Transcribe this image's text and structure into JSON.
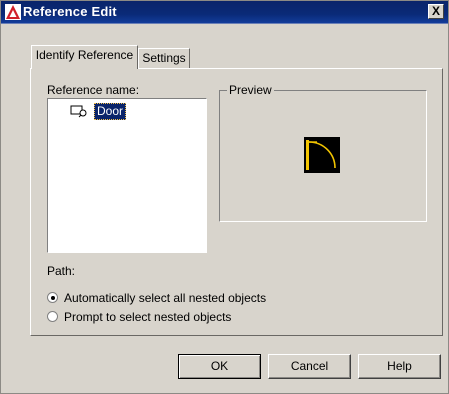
{
  "window": {
    "title": "Reference Edit",
    "close_label": "X"
  },
  "tabs": [
    {
      "label": "Identify Reference",
      "active": true
    },
    {
      "label": "Settings",
      "active": false
    }
  ],
  "reference": {
    "label": "Reference name:",
    "items": [
      {
        "label": "Door",
        "selected": true,
        "icon": "block-reference-icon"
      }
    ]
  },
  "preview": {
    "label": "Preview",
    "icon": "door-preview-icon"
  },
  "path": {
    "label": "Path:",
    "options": [
      {
        "label": "Automatically select all nested objects",
        "selected": true
      },
      {
        "label": "Prompt to select nested objects",
        "selected": false
      }
    ]
  },
  "buttons": {
    "ok": "OK",
    "cancel": "Cancel",
    "help": "Help"
  },
  "colors": {
    "title_bar": "#0a246a",
    "dialog_bg": "#d8d4cc",
    "selection": "#0a246a",
    "preview_arc": "#f2c400"
  }
}
